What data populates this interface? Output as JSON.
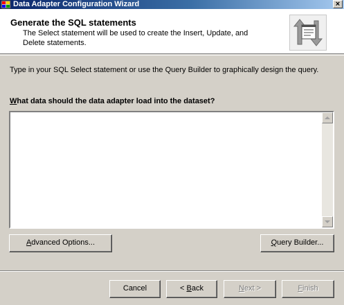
{
  "window": {
    "title": "Data Adapter Configuration Wizard",
    "close_glyph": "×"
  },
  "header": {
    "title": "Generate the SQL statements",
    "description": "The Select statement will be used to create the Insert, Update, and Delete statements.",
    "icon": "wizard-sql-icon"
  },
  "body": {
    "instruction": "Type in your SQL Select statement or use the Query Builder to graphically design the query.",
    "question_prefix": "W",
    "question_rest": "hat data should the data adapter load into the dataset?",
    "sql_value": ""
  },
  "buttons": {
    "advanced_prefix": "A",
    "advanced_rest": "dvanced Options...",
    "query_prefix": "Q",
    "query_rest": "uery Builder...",
    "cancel": "Cancel",
    "back_lead": "< ",
    "back_u": "B",
    "back_rest": "ack",
    "next_u": "N",
    "next_rest": "ext >",
    "finish_u": "F",
    "finish_rest": "inish"
  }
}
